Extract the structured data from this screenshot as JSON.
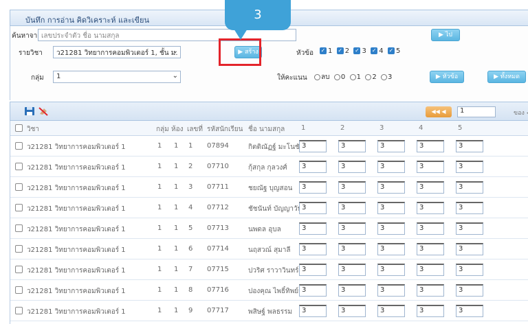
{
  "window": {
    "title": "บันทึก การอ่าน คิดวิเคราะห์ และเขียน"
  },
  "callout": {
    "number": "3"
  },
  "filters": {
    "search_label": "ค้นหาจาก",
    "search_placeholder": "เลขประจำตัว ชื่อ นามสกุล",
    "go_button": "ไป",
    "subject_label": "รายวิชา",
    "subject_selected": "ว21281 วิทยาการคอมพิวเตอร์ 1, ชั้น ม.",
    "create_button": "สร้าง",
    "topic_label": "หัวข้อ",
    "topics": [
      "1",
      "2",
      "3",
      "4",
      "5"
    ],
    "group_label": "กลุ่ม",
    "group_selected": "1",
    "score_label": "ให้คะแนน",
    "score_options": [
      "ลบ",
      "0",
      "1",
      "2",
      "3"
    ],
    "topic_button": "หัวข้อ",
    "save_all_button": "ทั้งหมด"
  },
  "pager": {
    "arrows": "◀◀ ◀",
    "page": "1",
    "of_label": "ของ ◀"
  },
  "table": {
    "headers": [
      "วิชา",
      "กลุ่ม",
      "ห้อง",
      "เลขที่",
      "รหัสนักเรียน",
      "ชื่อ นามสกุล",
      "1",
      "2",
      "3",
      "4",
      "5"
    ],
    "rows": [
      {
        "subject": "ว21281 วิทยาการคอมพิวเตอร์ 1",
        "group": "1",
        "room": "1",
        "no": "1",
        "id": "07894",
        "name": "กิตติณัฏฐ์ มะโนชัย",
        "scores": [
          "3",
          "3",
          "3",
          "3",
          "3"
        ]
      },
      {
        "subject": "ว21281 วิทยาการคอมพิวเตอร์ 1",
        "group": "1",
        "room": "1",
        "no": "2",
        "id": "07710",
        "name": "กุ้สกุล กุลวงศ์",
        "scores": [
          "3",
          "3",
          "3",
          "3",
          "3"
        ]
      },
      {
        "subject": "ว21281 วิทยาการคอมพิวเตอร์ 1",
        "group": "1",
        "room": "1",
        "no": "3",
        "id": "07711",
        "name": "ชยณัฐ บุญสอน",
        "scores": [
          "3",
          "3",
          "3",
          "3",
          "3"
        ]
      },
      {
        "subject": "ว21281 วิทยาการคอมพิวเตอร์ 1",
        "group": "1",
        "room": "1",
        "no": "4",
        "id": "07712",
        "name": "ชัชนันท์ บัญญาวัน",
        "scores": [
          "3",
          "3",
          "3",
          "3",
          "3"
        ]
      },
      {
        "subject": "ว21281 วิทยาการคอมพิวเตอร์ 1",
        "group": "1",
        "room": "1",
        "no": "5",
        "id": "07713",
        "name": "นพดล อุบล",
        "scores": [
          "3",
          "3",
          "3",
          "3",
          "3"
        ]
      },
      {
        "subject": "ว21281 วิทยาการคอมพิวเตอร์ 1",
        "group": "1",
        "room": "1",
        "no": "6",
        "id": "07714",
        "name": "นฤสวณ์ สุมาลี",
        "scores": [
          "3",
          "3",
          "3",
          "3",
          "3"
        ]
      },
      {
        "subject": "ว21281 วิทยาการคอมพิวเตอร์ 1",
        "group": "1",
        "room": "1",
        "no": "7",
        "id": "07715",
        "name": "ปวริศ ราวาวินทร์",
        "scores": [
          "3",
          "3",
          "3",
          "3",
          "3"
        ]
      },
      {
        "subject": "ว21281 วิทยาการคอมพิวเตอร์ 1",
        "group": "1",
        "room": "1",
        "no": "8",
        "id": "07716",
        "name": "ปองคุณ ไพธิ์ทิพย์วงษ์",
        "scores": [
          "3",
          "3",
          "3",
          "3",
          "3"
        ]
      },
      {
        "subject": "ว21281 วิทยาการคอมพิวเตอร์ 1",
        "group": "1",
        "room": "1",
        "no": "9",
        "id": "07717",
        "name": "พสิษฐ์ พลธรรม",
        "scores": [
          "3",
          "3",
          "3",
          "3",
          "3"
        ]
      }
    ]
  },
  "colors": {
    "accent": "#3fa2d8",
    "highlight": "#e3242b",
    "header_bg": "#dbe7f5"
  }
}
